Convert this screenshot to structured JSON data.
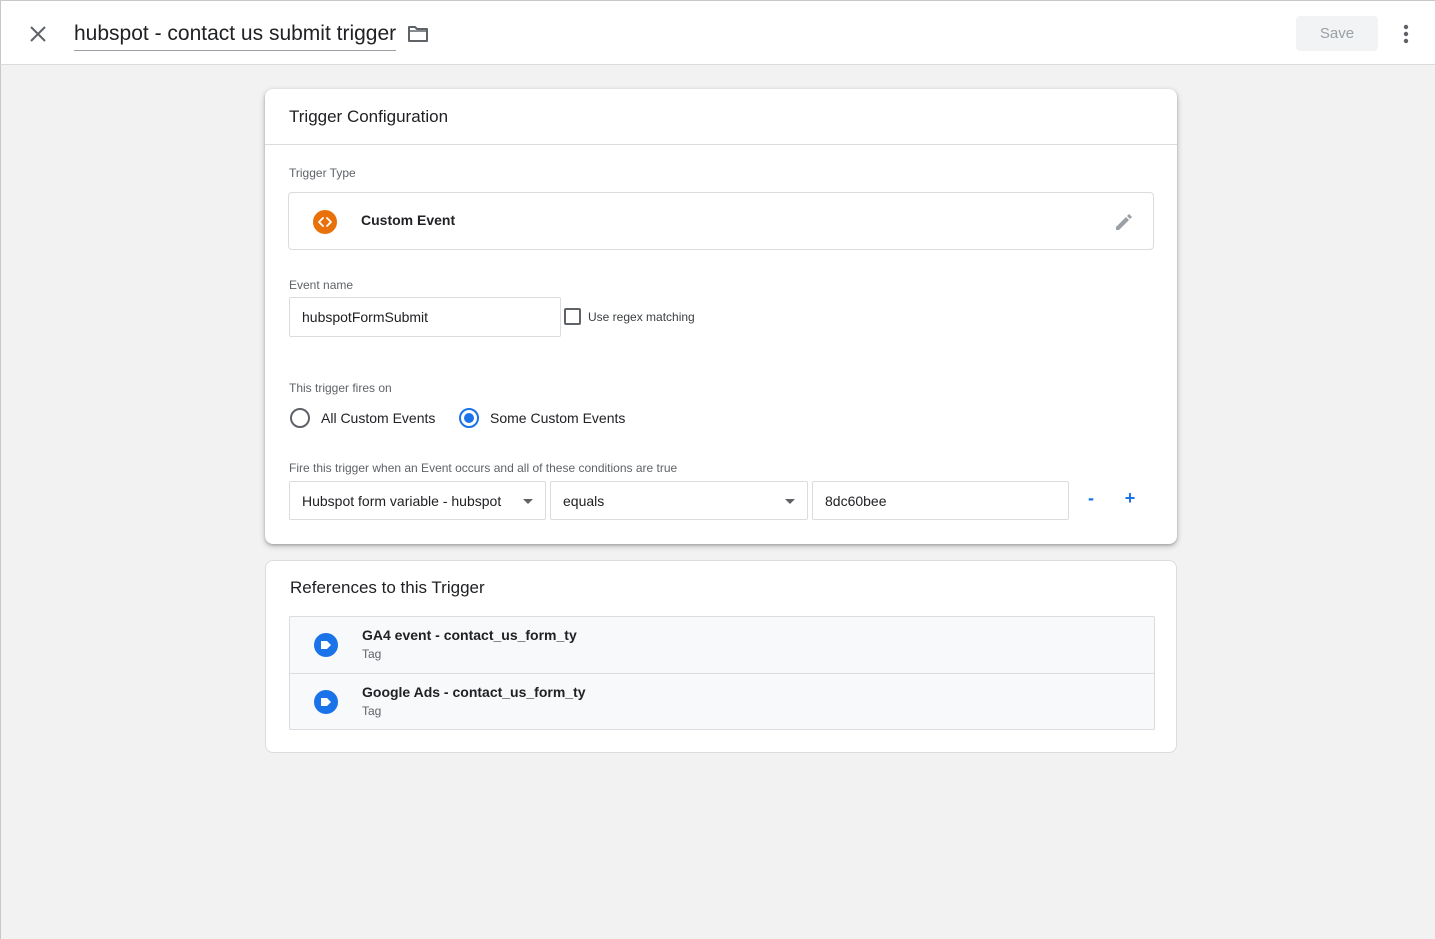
{
  "header": {
    "title": "hubspot - contact us submit trigger",
    "save_label": "Save"
  },
  "config": {
    "card_title": "Trigger Configuration",
    "trigger_type_label": "Trigger Type",
    "trigger_type_name": "Custom Event",
    "trigger_type_icon": "custom-event-icon",
    "event_name_label": "Event name",
    "event_name_value": "hubspotFormSubmit",
    "regex_label": "Use regex matching",
    "regex_checked": false,
    "fires_on_label": "This trigger fires on",
    "fires_options": [
      {
        "label": "All Custom Events",
        "checked": false
      },
      {
        "label": "Some Custom Events",
        "checked": true
      }
    ],
    "condition_label": "Fire this trigger when an Event occurs and all of these conditions are true",
    "condition": {
      "variable": "Hubspot form variable - hubspot",
      "operator": "equals",
      "value": "8dc60bee"
    },
    "remove_label": "-",
    "add_label": "+"
  },
  "references": {
    "card_title": "References to this Trigger",
    "items": [
      {
        "name": "GA4 event - contact_us_form_ty",
        "type": "Tag"
      },
      {
        "name": "Google Ads - contact_us_form_ty",
        "type": "Tag"
      }
    ]
  },
  "colors": {
    "accent": "#1a73e8",
    "custom_event_icon": "#e8710a"
  }
}
